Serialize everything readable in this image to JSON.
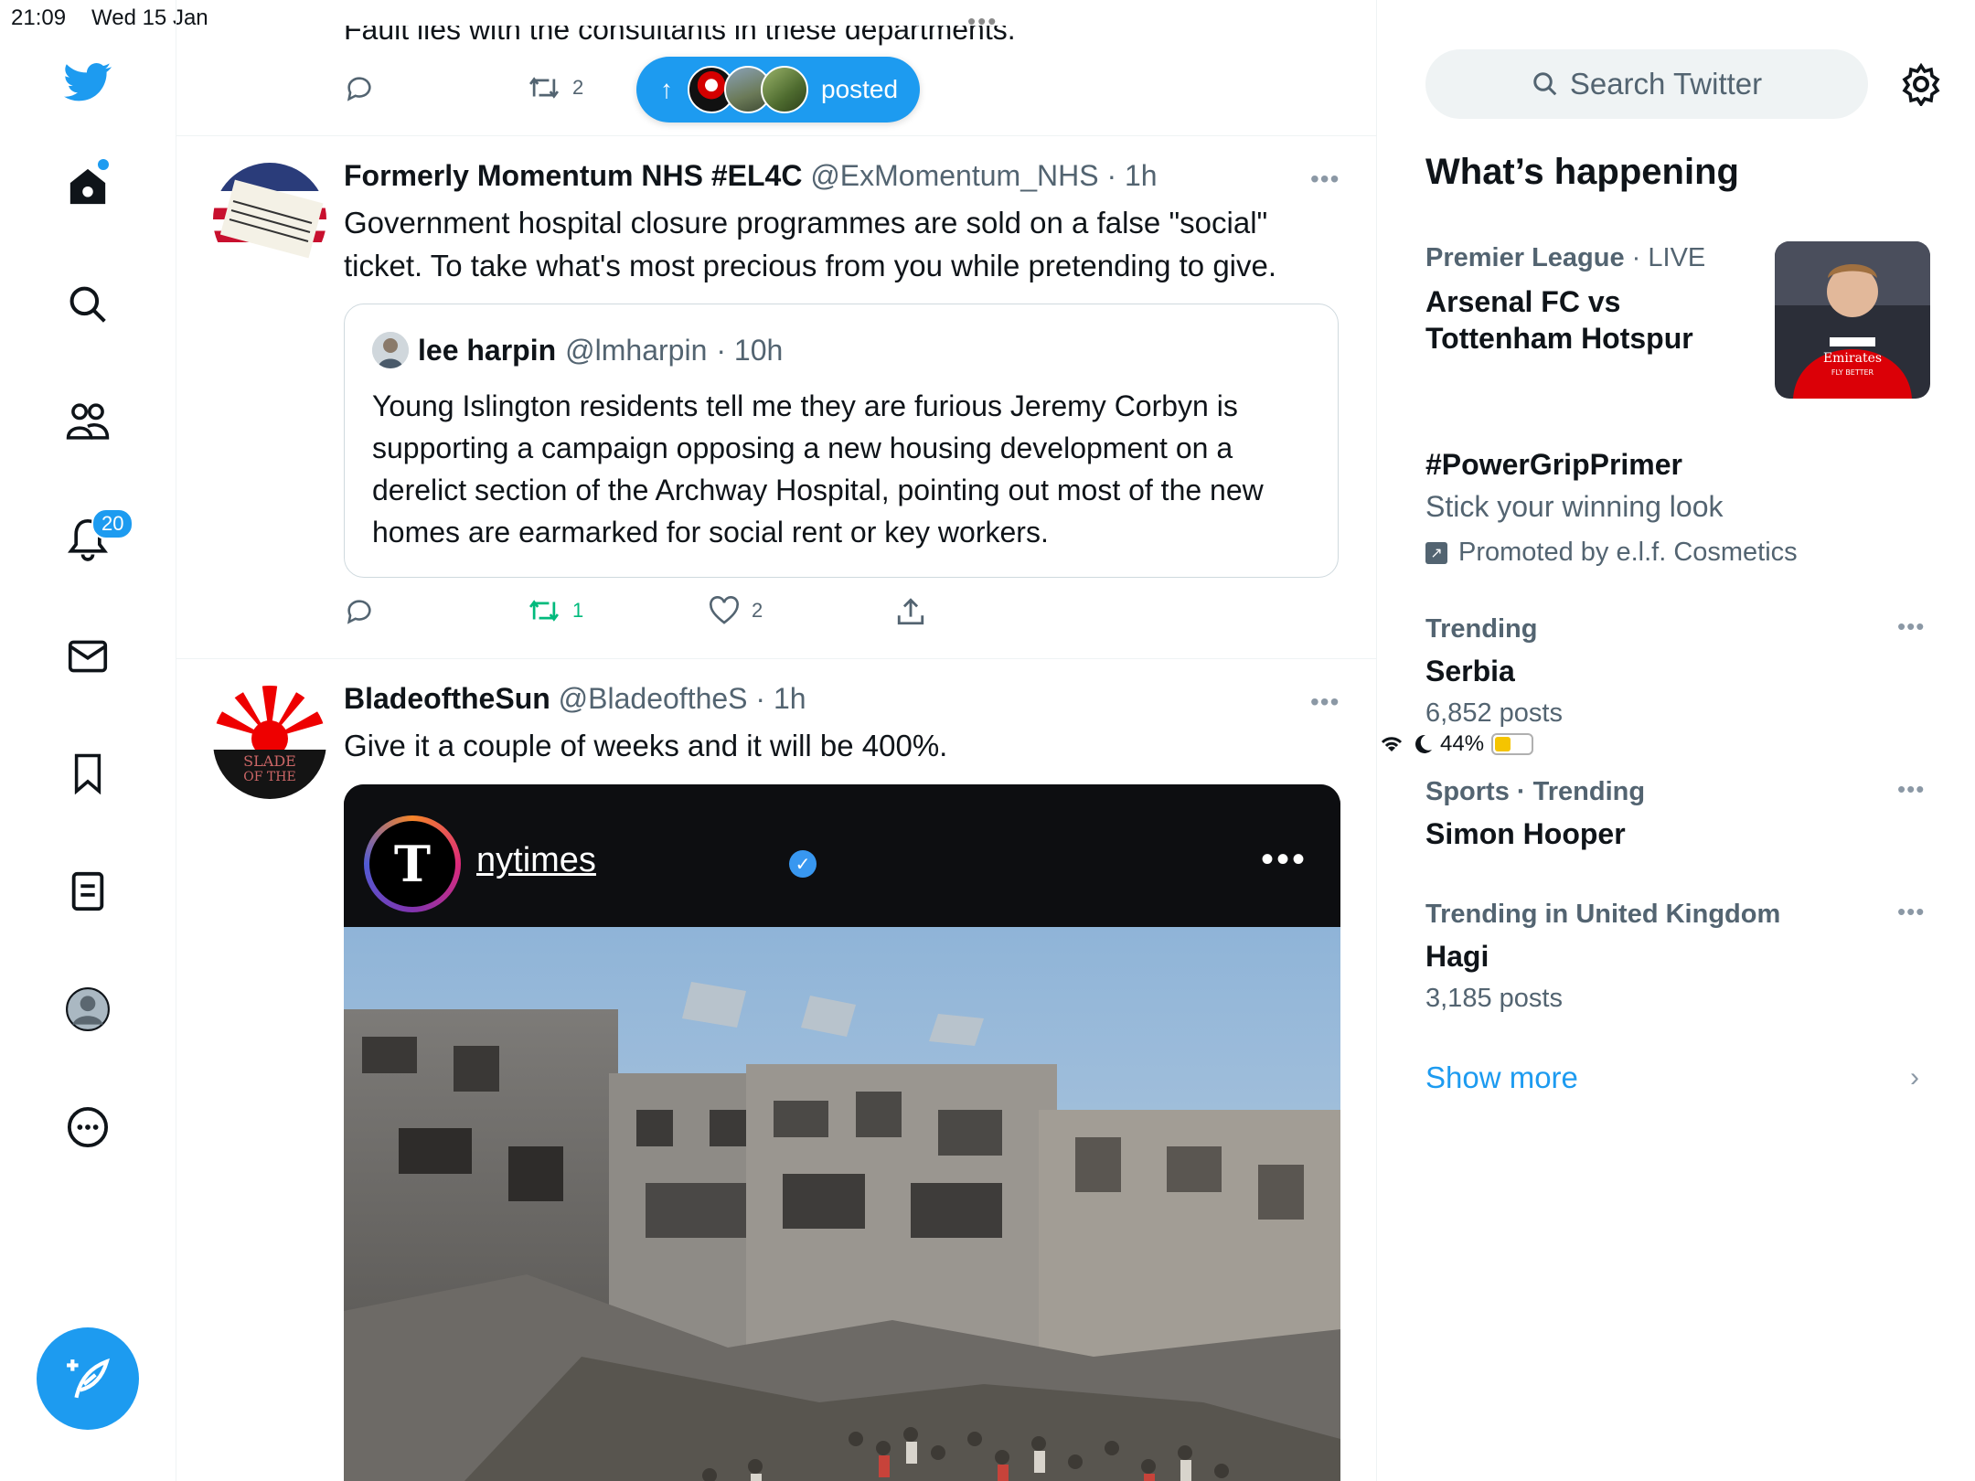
{
  "status_bar": {
    "time": "21:09",
    "date": "Wed 15 Jan",
    "battery": "44%",
    "battery_level": 0.44,
    "center_dots": "•••"
  },
  "nav": {
    "items": [
      "home-icon",
      "search-icon",
      "communities-icon",
      "notifications-icon",
      "messages-icon",
      "bookmarks-icon",
      "lists-icon",
      "profile-icon",
      "more-icon"
    ],
    "notifications_count": "20",
    "compose_icon": "compose-icon"
  },
  "timeline": {
    "previous_tweet_text": "Fault lies with the consultants in these departments.",
    "previous_tweet_retweets": "2",
    "new_posts_pill": {
      "arrow": "↑",
      "label": "posted"
    },
    "tweets": [
      {
        "name": "Formerly Momentum NHS #EL4C",
        "handle": "@ExMomentum_NHS",
        "time": "· 1h",
        "more": "•••",
        "text": "Government hospital closure programmes are sold on a false \"social\" ticket. To take what's most precious from you while pretending to give.",
        "quote": {
          "name": "lee harpin",
          "handle": "@lmharpin",
          "time": "· 10h",
          "text": "Young Islington residents tell me they are furious Jeremy Corbyn is supporting a campaign opposing a new housing development on a derelict section of the Archway Hospital, pointing out most of the new homes are earmarked for social rent or key workers."
        },
        "retweets": "1",
        "likes": "2"
      },
      {
        "name": "BladeoftheSun",
        "handle": "@BladeoftheS",
        "time": "· 1h",
        "more": "•••",
        "text": "Give it a couple of weeks and it will be 400%.",
        "media": {
          "ig_user": "nytimes",
          "ig_logo_letter": "T",
          "ig_more": "•••"
        }
      }
    ]
  },
  "sidebar": {
    "search_placeholder": "Search Twitter",
    "heading": "What’s happening",
    "trends": [
      {
        "meta_category": "Premier League",
        "meta_extra": " · LIVE",
        "title": "Arsenal FC vs Tottenham Hotspur",
        "sub": ""
      },
      {
        "meta_category": "",
        "meta_extra": "",
        "title": "#PowerGripPrimer",
        "sub": "Stick your winning look",
        "promo": "Promoted by e.l.f. Cosmetics"
      },
      {
        "meta_category": "Trending",
        "meta_extra": "",
        "title": "Serbia",
        "sub": "6,852 posts",
        "more": "•••"
      },
      {
        "meta_category": "Sports · Trending",
        "meta_extra": "",
        "title": "Simon Hooper",
        "sub": "",
        "more": "•••"
      },
      {
        "meta_category": "Trending in United Kingdom",
        "meta_extra": "",
        "title": "Hagi",
        "sub": "3,185 posts",
        "more": "•••"
      }
    ],
    "show_more": "Show more",
    "chevron": "›"
  },
  "colors": {
    "accent": "#1d9bf0",
    "retweet_green": "#00ba7c",
    "text": "#0f1419",
    "muted": "#536471"
  }
}
